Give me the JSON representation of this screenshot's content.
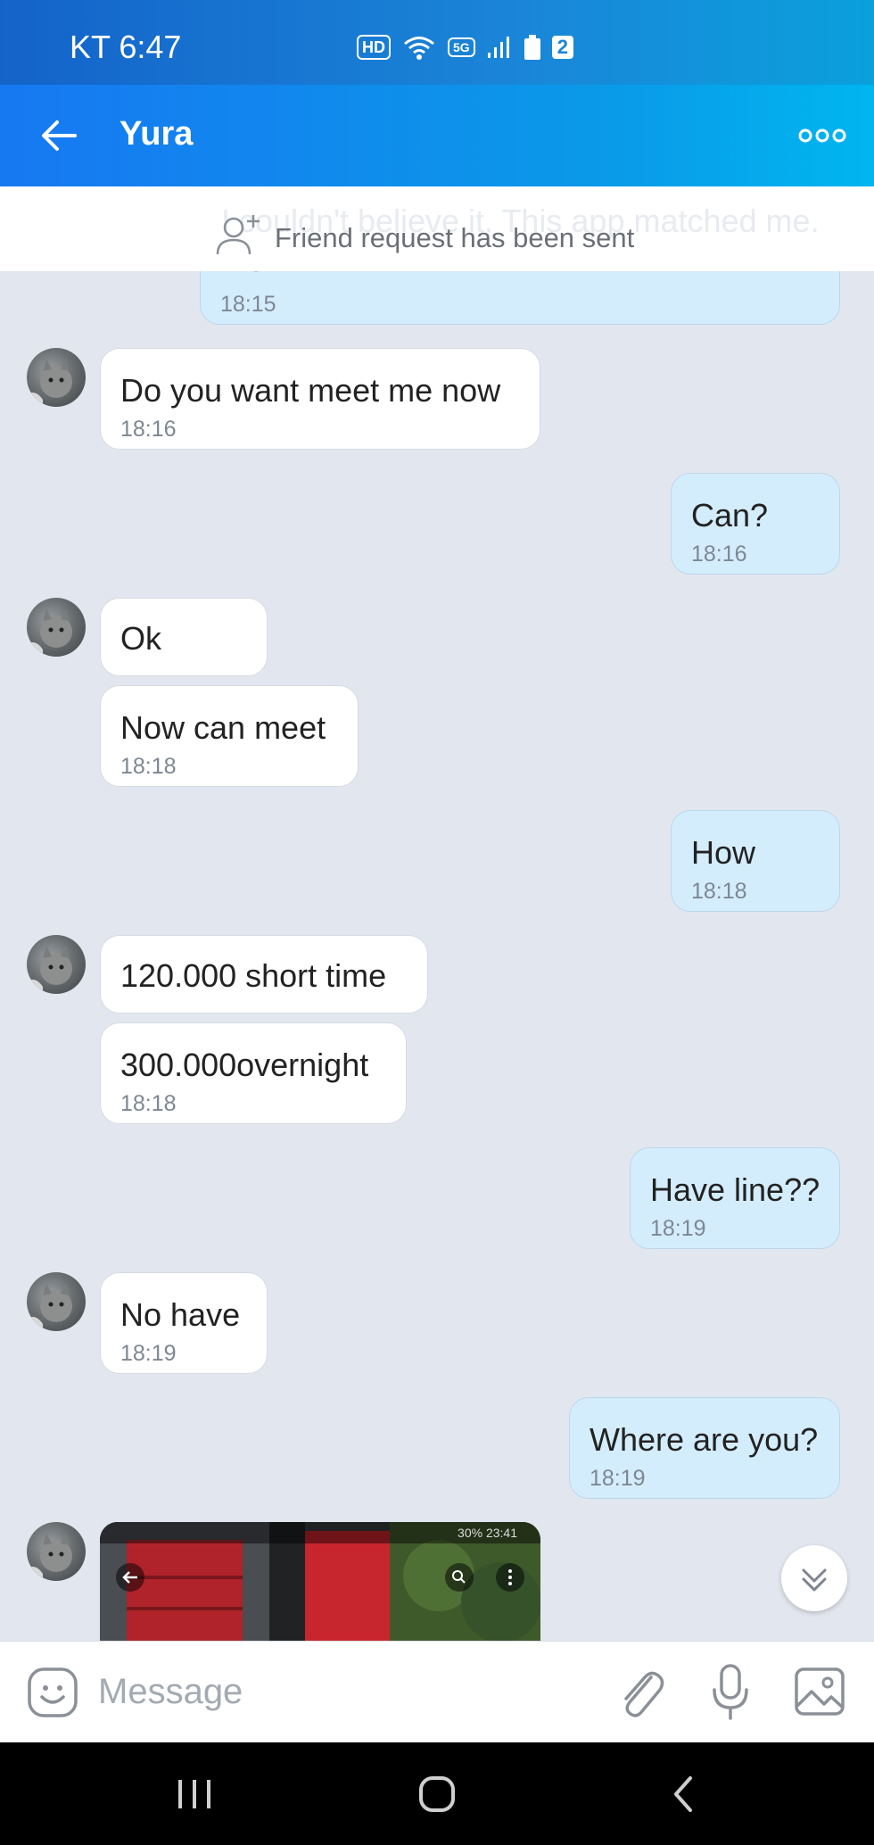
{
  "status_bar": {
    "carrier_time": "KT 6:47",
    "hd_label": "HD",
    "network_label": "5G",
    "sim_label": "2"
  },
  "header": {
    "title": "Yura"
  },
  "notice": {
    "ghost_text": "I couldn't believe it. This app matched me.",
    "text": "Friend request has been sent"
  },
  "messages": [
    {
      "dir": "out",
      "text": "me.",
      "time": "18:15"
    },
    {
      "dir": "in",
      "text": "Do you want meet me now",
      "time": "18:16"
    },
    {
      "dir": "out",
      "text": "Can?",
      "time": "18:16"
    },
    {
      "dir": "in",
      "text": "Ok",
      "time": ""
    },
    {
      "dir": "in",
      "text": "Now can meet",
      "time": "18:18"
    },
    {
      "dir": "out",
      "text": "How",
      "time": "18:18"
    },
    {
      "dir": "in",
      "text": "120.000 short time",
      "time": ""
    },
    {
      "dir": "in",
      "text": "300.000overnight",
      "time": "18:18"
    },
    {
      "dir": "out",
      "text": "Have line??",
      "time": "18:19"
    },
    {
      "dir": "in",
      "text": "No have",
      "time": "18:19"
    },
    {
      "dir": "out",
      "text": "Where are you?",
      "time": "18:19"
    }
  ],
  "photo_preview": {
    "status_text": "30%  23:41"
  },
  "composer": {
    "placeholder": "Message"
  },
  "colors": {
    "header_gradient_start": "#1778f2",
    "header_gradient_end": "#00b6f0",
    "incoming_bubble": "#ffffff",
    "outgoing_bubble": "#d4edfd",
    "chat_background": "#e2e7ef"
  },
  "icons": [
    "back-arrow-icon",
    "more-dots-icon",
    "add-friend-icon",
    "emoji-icon",
    "attach-icon",
    "microphone-icon",
    "image-icon",
    "chevron-double-down-icon",
    "recents-nav-icon",
    "home-nav-icon",
    "back-nav-icon"
  ]
}
